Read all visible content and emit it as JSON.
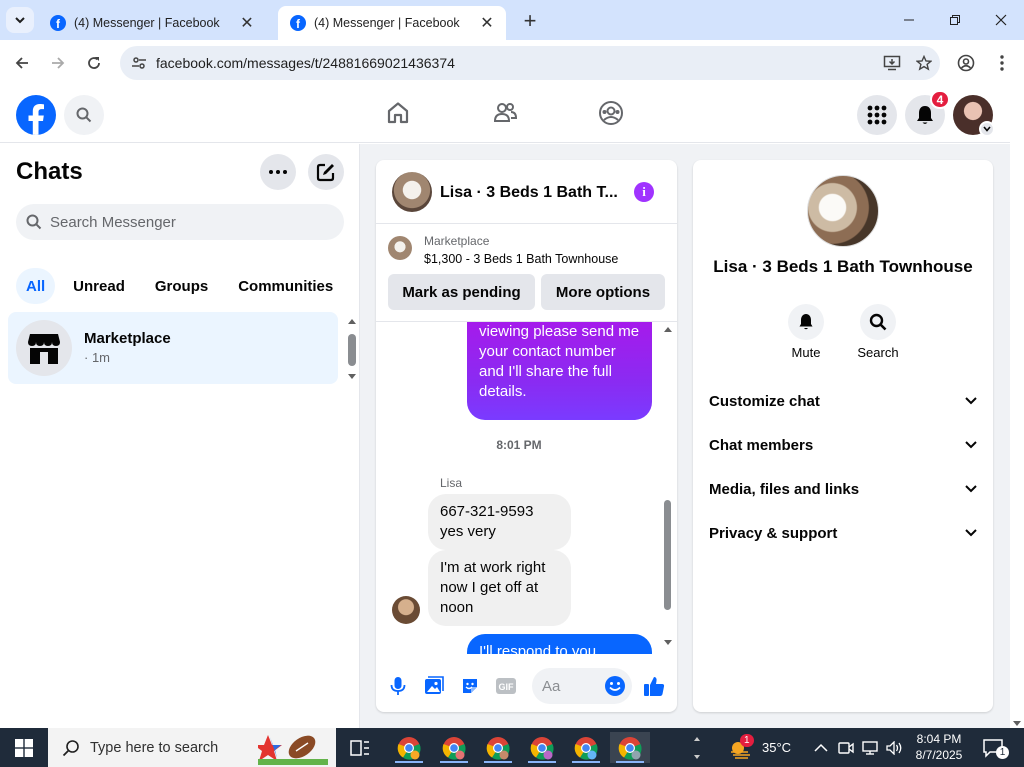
{
  "browser": {
    "tabs": [
      {
        "title": "(4) Messenger | Facebook",
        "active": false
      },
      {
        "title": "(4) Messenger | Facebook",
        "active": true
      }
    ],
    "url": "facebook.com/messages/t/24881669021436374"
  },
  "fb_header": {
    "notification_count": "4",
    "icons": [
      "facebook-logo",
      "search-icon",
      "home-icon",
      "friends-icon",
      "groups-icon",
      "menu-grid-icon",
      "bell-icon",
      "profile-avatar"
    ]
  },
  "chats": {
    "title": "Chats",
    "search_placeholder": "Search Messenger",
    "filters": [
      "All",
      "Unread",
      "Groups",
      "Communities"
    ],
    "active_filter": "All",
    "list": [
      {
        "name": "Marketplace",
        "time": "· 1m"
      }
    ]
  },
  "conversation": {
    "title": "Lisa · 3 Beds 1 Bath T...",
    "marketplace_label": "Marketplace",
    "listing": "$1,300 - 3 Beds 1 Bath Townhouse",
    "mark_pending_label": "Mark as pending",
    "more_options_label": "More options",
    "messages": {
      "outgoing_partial": "are interested in viewing please send me your contact number and I'll share the full details.",
      "timestamp": "8:01 PM",
      "sender": "Lisa",
      "incoming_1": "667-321-9593 yes very",
      "incoming_2": "I'm at work right now I get off at noon",
      "outgoing_next": "I'll respond to you"
    },
    "composer_placeholder": "Aa"
  },
  "details": {
    "name": "Lisa · 3 Beds 1 Bath Townhouse",
    "actions": [
      {
        "label": "Mute",
        "icon": "bell-icon"
      },
      {
        "label": "Search",
        "icon": "search-icon"
      }
    ],
    "sections": [
      "Customize chat",
      "Chat members",
      "Media, files and links",
      "Privacy & support"
    ]
  },
  "taskbar": {
    "search_placeholder": "Type here to search",
    "weather": "35°C",
    "weather_badge": "1",
    "time": "8:04 PM",
    "date": "8/7/2025",
    "notification_count": "1"
  },
  "colors": {
    "facebook_blue": "#0866ff",
    "purple_bubble": "#9b2bf0",
    "notification_red": "#e41e3f",
    "tabstrip": "#d3e3fd",
    "taskbar": "#1f2b3a"
  }
}
